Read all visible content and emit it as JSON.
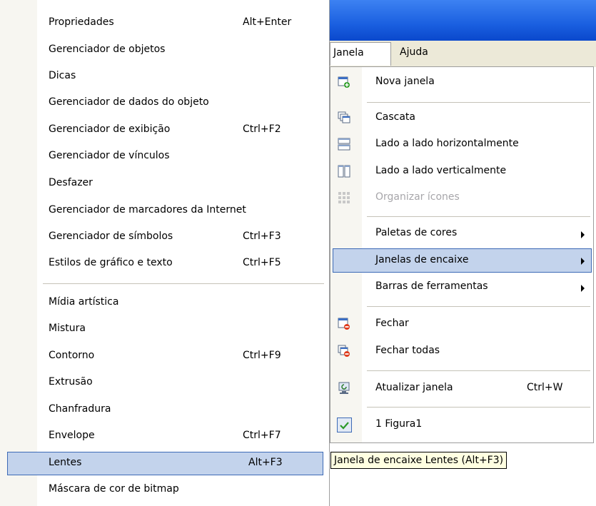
{
  "left_menu": {
    "group1": [
      {
        "label": "Propriedades",
        "shortcut": "Alt+Enter"
      },
      {
        "label": "Gerenciador de objetos",
        "shortcut": ""
      },
      {
        "label": "Dicas",
        "shortcut": ""
      },
      {
        "label": "Gerenciador de dados do objeto",
        "shortcut": ""
      },
      {
        "label": "Gerenciador de exibição",
        "shortcut": "Ctrl+F2"
      },
      {
        "label": "Gerenciador de vínculos",
        "shortcut": ""
      },
      {
        "label": "Desfazer",
        "shortcut": ""
      },
      {
        "label": "Gerenciador de marcadores da Internet",
        "shortcut": ""
      },
      {
        "label": "Gerenciador de símbolos",
        "shortcut": "Ctrl+F3"
      },
      {
        "label": "Estilos de gráfico e texto",
        "shortcut": "Ctrl+F5"
      }
    ],
    "group2": [
      {
        "label": "Mídia artística",
        "shortcut": ""
      },
      {
        "label": "Mistura",
        "shortcut": ""
      },
      {
        "label": "Contorno",
        "shortcut": "Ctrl+F9"
      },
      {
        "label": "Extrusão",
        "shortcut": ""
      },
      {
        "label": "Chanfradura",
        "shortcut": ""
      },
      {
        "label": "Envelope",
        "shortcut": "Ctrl+F7"
      },
      {
        "label": "Lentes",
        "shortcut": "Alt+F3",
        "highlighted": true
      },
      {
        "label": "Máscara de cor de bitmap",
        "shortcut": ""
      }
    ]
  },
  "menubar": {
    "janela": "Janela",
    "ajuda": "Ajuda"
  },
  "janela_menu": {
    "nova_janela": "Nova janela",
    "cascata": "Cascata",
    "lado_horizontal": "Lado a lado horizontalmente",
    "lado_vertical": "Lado a lado verticalmente",
    "organizar_icones": "Organizar ícones",
    "paletas": "Paletas de cores",
    "janelas_encaixe": "Janelas de encaixe",
    "barras_ferramentas": "Barras de ferramentas",
    "fechar": "Fechar",
    "fechar_todas": "Fechar todas",
    "atualizar": "Atualizar janela",
    "atualizar_shortcut": "Ctrl+W",
    "figura": "1 Figura1"
  },
  "tooltip": "Janela de encaixe Lentes (Alt+F3)",
  "colors": {
    "highlight_fill": "#c3d3ec",
    "highlight_border": "#3d6ab6",
    "titlebar": "#1a5fe0",
    "menubar": "#ece9d8",
    "tooltip_bg": "#ffffe1"
  }
}
